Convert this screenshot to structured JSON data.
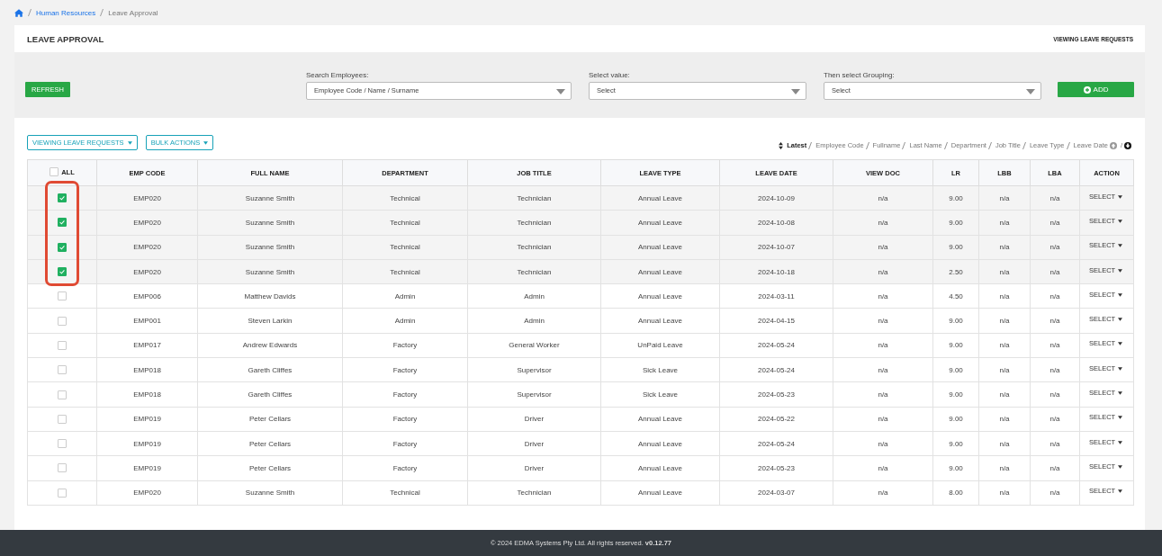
{
  "breadcrumb": [
    {
      "label": "Human Resources",
      "link": true
    },
    {
      "label": "Leave Approval",
      "link": false
    }
  ],
  "page": {
    "title": "LEAVE APPROVAL",
    "subtitle": "VIEWING LEAVE REQUESTS"
  },
  "filters": {
    "refresh": "REFRESH",
    "add": "ADD",
    "fields": [
      {
        "label": "Search Employees:",
        "value": "Employee Code / Name / Surname"
      },
      {
        "label": "Select value:",
        "value": "Select"
      },
      {
        "label": "Then select Grouping:",
        "value": "Select"
      }
    ]
  },
  "toolbar": {
    "buttons": [
      "VIEWING LEAVE REQUESTS",
      "BULK ACTIONS"
    ],
    "sort_options": [
      {
        "label": "Latest",
        "selected": true
      },
      {
        "label": "Employee Code",
        "selected": false
      },
      {
        "label": "Fullname",
        "selected": false
      },
      {
        "label": "Last Name",
        "selected": false
      },
      {
        "label": "Department",
        "selected": false
      },
      {
        "label": "Job Title",
        "selected": false
      },
      {
        "label": "Leave Type",
        "selected": false
      },
      {
        "label": "Leave Date",
        "selected": false
      }
    ],
    "direction": [
      {
        "kind": "asc",
        "selected": false
      },
      {
        "kind": "desc",
        "selected": true
      }
    ],
    "direction_separator": "/"
  },
  "table": {
    "select_all": {
      "label": "ALL",
      "checked": false
    },
    "columns": [
      "EMP CODE",
      "FULL NAME",
      "DEPARTMENT",
      "JOB TITLE",
      "LEAVE TYPE",
      "LEAVE DATE",
      "VIEW DOC",
      "LR",
      "LBB",
      "LBA",
      "ACTION"
    ],
    "rows": [
      {
        "selected": true,
        "cells": [
          "EMP020",
          "Suzanne Smith",
          "Technical",
          "Technician",
          "Annual Leave",
          "2024-10-09",
          "n/a",
          "9.00",
          "n/a",
          "n/a"
        ],
        "action": "SELECT"
      },
      {
        "selected": true,
        "cells": [
          "EMP020",
          "Suzanne Smith",
          "Technical",
          "Technician",
          "Annual Leave",
          "2024-10-08",
          "n/a",
          "9.00",
          "n/a",
          "n/a"
        ],
        "action": "SELECT"
      },
      {
        "selected": true,
        "cells": [
          "EMP020",
          "Suzanne Smith",
          "Technical",
          "Technician",
          "Annual Leave",
          "2024-10-07",
          "n/a",
          "9.00",
          "n/a",
          "n/a"
        ],
        "action": "SELECT"
      },
      {
        "selected": true,
        "cells": [
          "EMP020",
          "Suzanne Smith",
          "Technical",
          "Technician",
          "Annual Leave",
          "2024-10-18",
          "n/a",
          "2.50",
          "n/a",
          "n/a"
        ],
        "action": "SELECT"
      },
      {
        "selected": false,
        "cells": [
          "EMP006",
          "Matthew Davids",
          "Admin",
          "Admin",
          "Annual Leave",
          "2024-03-11",
          "n/a",
          "4.50",
          "n/a",
          "n/a"
        ],
        "action": "SELECT"
      },
      {
        "selected": false,
        "cells": [
          "EMP001",
          "Steven Larkin",
          "Admin",
          "Admin",
          "Annual Leave",
          "2024-04-15",
          "n/a",
          "9.00",
          "n/a",
          "n/a"
        ],
        "action": "SELECT"
      },
      {
        "selected": false,
        "cells": [
          "EMP017",
          "Andrew Edwards",
          "Factory",
          "General Worker",
          "UnPaid Leave",
          "2024-05-24",
          "n/a",
          "9.00",
          "n/a",
          "n/a"
        ],
        "action": "SELECT"
      },
      {
        "selected": false,
        "cells": [
          "EMP018",
          "Gareth Cliffes",
          "Factory",
          "Supervisor",
          "Sick Leave",
          "2024-05-24",
          "n/a",
          "9.00",
          "n/a",
          "n/a"
        ],
        "action": "SELECT"
      },
      {
        "selected": false,
        "cells": [
          "EMP018",
          "Gareth Cliffes",
          "Factory",
          "Supervisor",
          "Sick Leave",
          "2024-05-23",
          "n/a",
          "9.00",
          "n/a",
          "n/a"
        ],
        "action": "SELECT"
      },
      {
        "selected": false,
        "cells": [
          "EMP019",
          "Peter Cellars",
          "Factory",
          "Driver",
          "Annual Leave",
          "2024-05-22",
          "n/a",
          "9.00",
          "n/a",
          "n/a"
        ],
        "action": "SELECT"
      },
      {
        "selected": false,
        "cells": [
          "EMP019",
          "Peter Cellars",
          "Factory",
          "Driver",
          "Annual Leave",
          "2024-05-24",
          "n/a",
          "9.00",
          "n/a",
          "n/a"
        ],
        "action": "SELECT"
      },
      {
        "selected": false,
        "cells": [
          "EMP019",
          "Peter Cellars",
          "Factory",
          "Driver",
          "Annual Leave",
          "2024-05-23",
          "n/a",
          "9.00",
          "n/a",
          "n/a"
        ],
        "action": "SELECT"
      },
      {
        "selected": false,
        "cells": [
          "EMP020",
          "Suzanne Smith",
          "Technical",
          "Technician",
          "Annual Leave",
          "2024-03-07",
          "n/a",
          "8.00",
          "n/a",
          "n/a"
        ],
        "action": "SELECT"
      }
    ]
  },
  "footer": "© 2024 EDMA Systems Pty Ltd. All rights reserved. **v0.12.77**"
}
